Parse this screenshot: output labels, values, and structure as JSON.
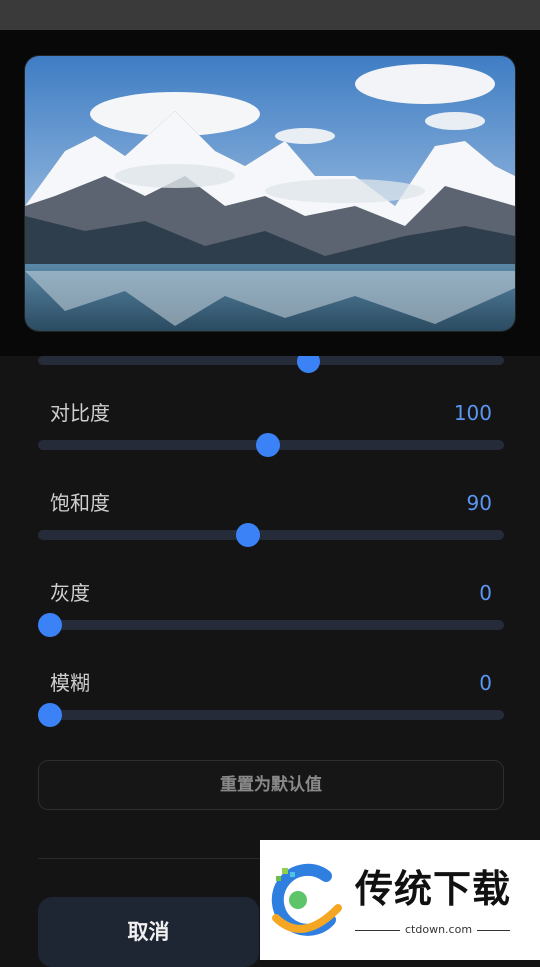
{
  "preview": {
    "image_description": ""
  },
  "sliders": [
    {
      "label": "对比度",
      "value": "100",
      "level": 0.496
    },
    {
      "label": "饱和度",
      "value": "90",
      "level": 0.45
    },
    {
      "label": "灰度",
      "value": "0",
      "level": 0
    },
    {
      "label": "模糊",
      "value": "0",
      "level": 0
    }
  ],
  "partial_slider": {
    "level": 0.496
  },
  "reset_label": "重置为默认值",
  "cancel_label": "取消",
  "watermark": {
    "title": "传统下载",
    "url": "ctdown.com"
  },
  "colors": {
    "accent": "#3b82f6",
    "value_text": "#5a97f5",
    "track": "#252b38",
    "background": "#141414"
  }
}
